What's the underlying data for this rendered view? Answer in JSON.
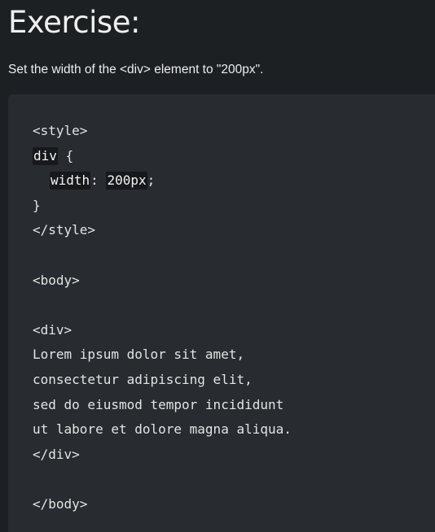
{
  "exercise": {
    "title": "Exercise:",
    "instruction": "Set the width of the <div> element to \"200px\"."
  },
  "code": {
    "style_open": "<style>",
    "selector_field_value": "div",
    "brace_open": " {",
    "property_field_value": "width",
    "colon": ": ",
    "value_field_value": "200px",
    "semicolon": ";",
    "brace_close": "}",
    "style_close": "</style>",
    "body_open": "<body>",
    "div_open": "<div>",
    "text_lines": [
      "Lorem ipsum dolor sit amet,",
      "consectetur adipiscing elit,",
      "sed do eiusmod tempor incididunt",
      "ut labore et dolore magna aliqua."
    ],
    "div_close": "</div>",
    "body_close": "</body>"
  }
}
